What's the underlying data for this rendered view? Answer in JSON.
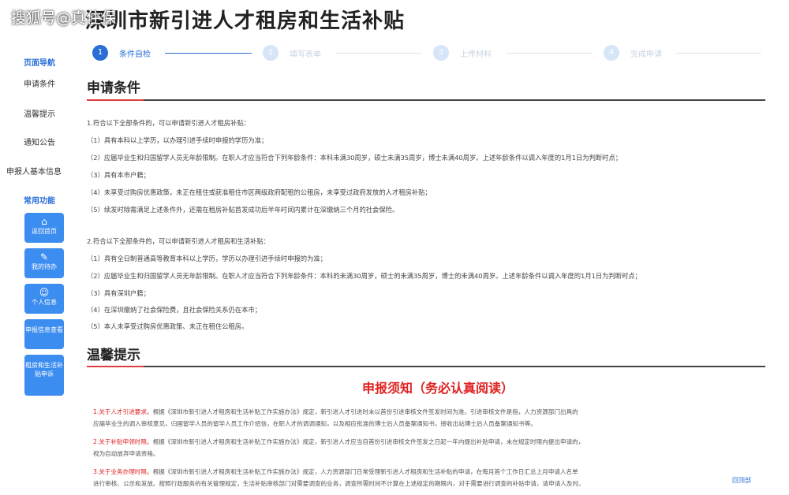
{
  "watermark": "搜狐号@真住保",
  "title": "深圳市新引进人才租房和生活补贴",
  "sidebar": {
    "nav_heading": "页面导航",
    "nav_items": [
      "申请条件",
      "温馨提示",
      "通知公告",
      "申报人基本信息"
    ],
    "tools_heading": "常用功能",
    "tiles": [
      {
        "icon": "⌂",
        "label": "返回首页"
      },
      {
        "icon": "✎",
        "label": "我的待办"
      },
      {
        "icon": "☺",
        "label": "个人信息"
      },
      {
        "icon": "",
        "label": "申报信息查看"
      },
      {
        "icon": "",
        "label": "租房和生活补贴申诉"
      }
    ]
  },
  "steps": [
    {
      "num": "1",
      "label": "条件自检",
      "active": true
    },
    {
      "num": "2",
      "label": "填写表单",
      "active": false
    },
    {
      "num": "3",
      "label": "上传材料",
      "active": false
    },
    {
      "num": "4",
      "label": "完成申请",
      "active": false
    }
  ],
  "conditions": {
    "heading": "申请条件",
    "rent_intro": "1.符合以下全部条件的，可以申请新引进人才租房补贴：",
    "rent_items": [
      "（1）具有本科以上学历，以办理引进手续时申报的学历为准；",
      "（2）应届毕业生和归国留学人员无年龄限制。在职人才应当符合下列年龄条件：本科未满30周岁，硕士未满35周岁，博士未满40周岁。上述年龄条件以调入年度的1月1日为判断时点；",
      "（3）具有本市户籍；",
      "（4）未享受过购房优惠政策，未正在租住或获准租住市区两级政府配租的公租房，未享受过政府发放的人才租房补贴；",
      "（5）续发时除需满足上述条件外，还需在租房补贴首发成功后半年时间内累计在深缴纳三个月的社会保险。"
    ],
    "life_intro": "2.符合以下全部条件的，可以申请新引进人才租房和生活补贴：",
    "life_items": [
      "（1）具有全日制普通高等教育本科以上学历，学历以办理引进手续时申报的为准；",
      "（2）应届毕业生和归国留学人员无年龄限制。在职人才应当符合下列年龄条件：本科的未满30周岁，硕士的未满35周岁，博士的未满40周岁。上述年龄条件以调入年度的1月1日为判断时点；",
      "（3）具有深圳户籍；",
      "（4）在深圳缴纳了社会保险费，且社会保险关系仍在本市；",
      "（5）本人未享受过购房优惠政策、未正在租住公租房。"
    ]
  },
  "tips": {
    "heading": "温馨提示",
    "notice_title": "申报须知（务必认真阅读）",
    "notice_lines": [
      {
        "red": "1.关于人才引进要求。",
        "rest": "根据《深圳市新引进人才租房和生活补贴工作实施办法》规定，新引进人才引进时未以首份引进审核文件签发时间为准。引进审核文件是指，人力资源部门出具的"
      },
      {
        "red": "",
        "rest": "应届毕业生的调入审核意见，归国留学人员的留学人员工作介绍信，在职人才的调调通知，以及相应批准的博士后人员备案通知书，接收出站博士后人员备案通知书等。"
      },
      {
        "red": "2.关于补贴申领时限。",
        "rest": "根据《深圳市新引进人才租房和生活补贴工作实施办法》规定，新引进人才应当自首份引进审核文件签发之日起一年内提出补贴申请，未在规定时限内提出申请的，"
      },
      {
        "red": "",
        "rest": "视为自动放弃申请资格。"
      },
      {
        "red": "3.关于业务办理时限。",
        "rest": "根据《深圳市新引进人才租房和生活补贴工作实施办法》规定，人力资源部门日常受理新引进人才租房和生活补贴的申请，在每月首个工作日汇总上月申请人名单"
      },
      {
        "red": "",
        "rest": "进行审核、公示和发放。按照行政服务的有关管理规定，生活补贴审核部门对需要调查的业务，调查所需时间不计算在上述规定的期限内，对于需要进行调查的补贴申请，请申请人及时。"
      }
    ],
    "corner_link": "回顶部"
  }
}
